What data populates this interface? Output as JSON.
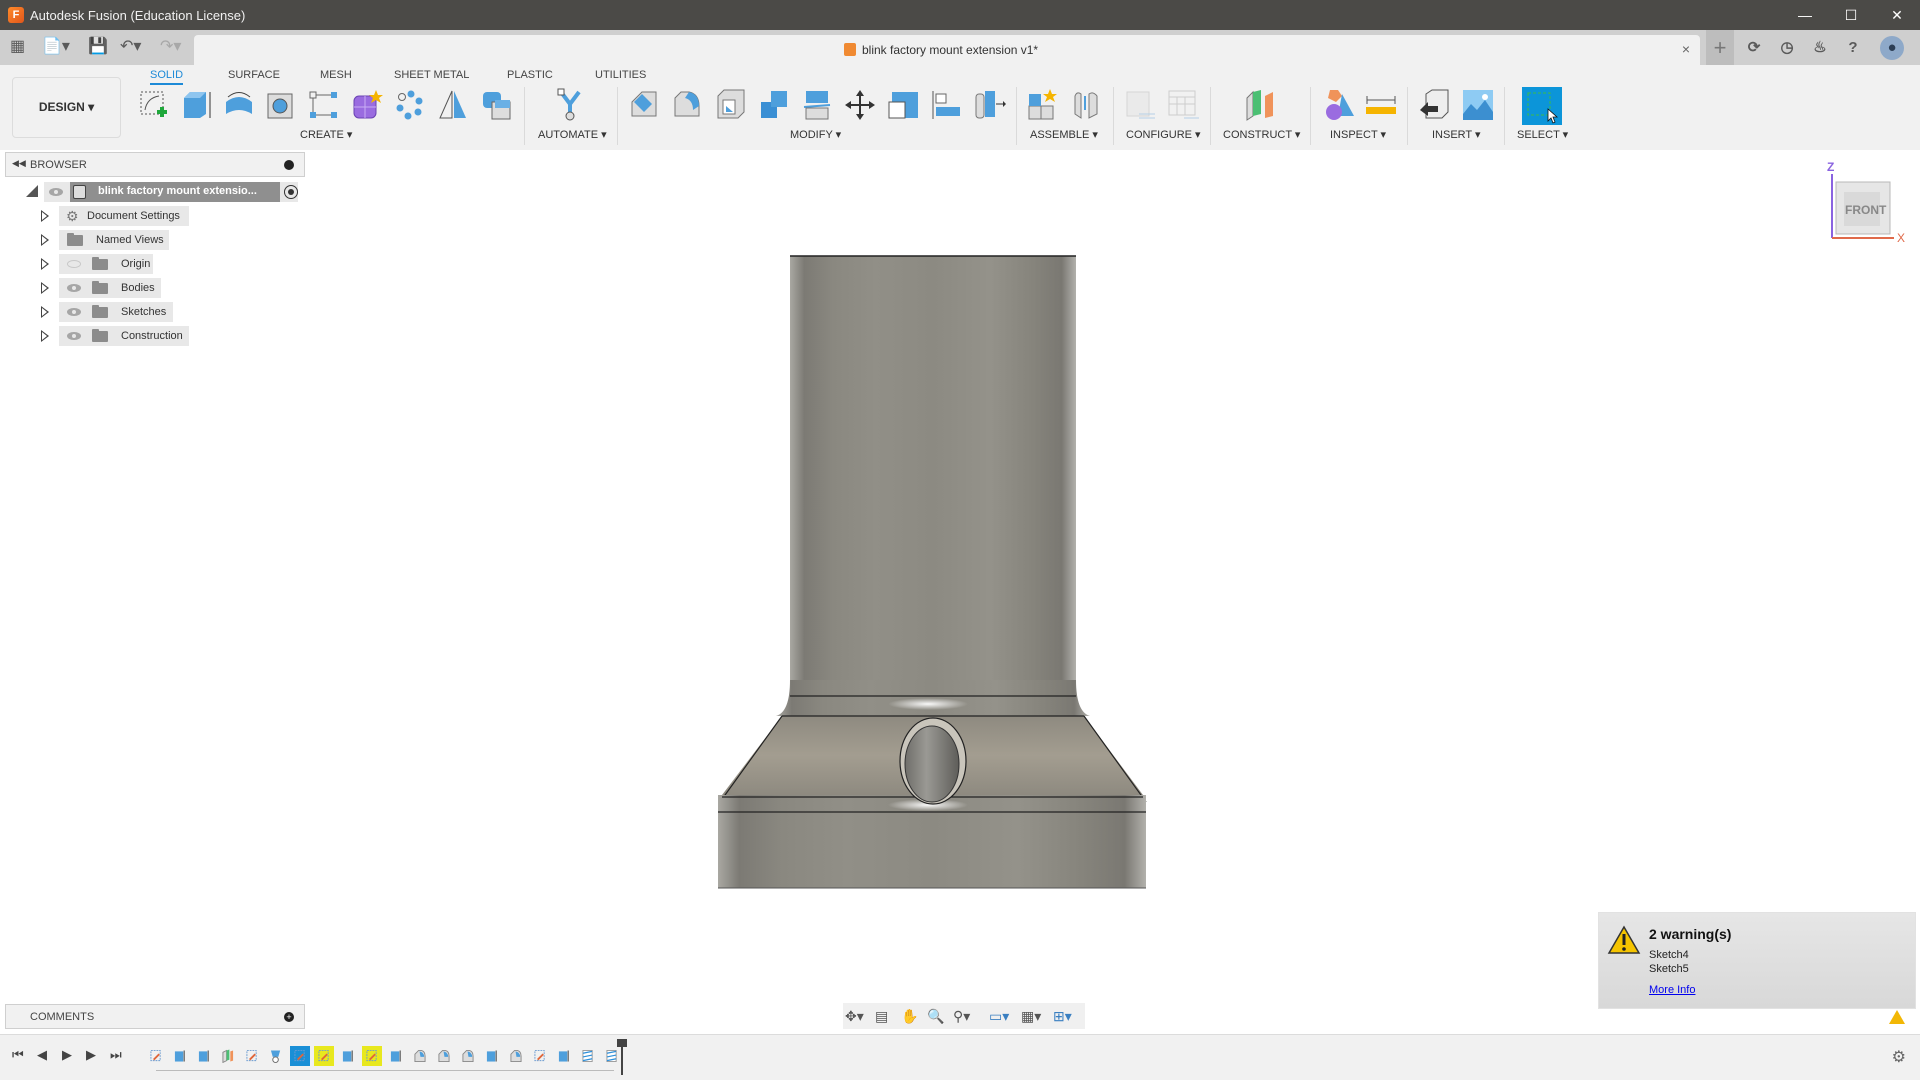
{
  "window": {
    "title": "Autodesk Fusion (Education License)",
    "controls": [
      "minimize",
      "maximize",
      "close"
    ]
  },
  "tabbar": {
    "quick_access": [
      "grid-menu",
      "file-menu",
      "save",
      "undo",
      "redo"
    ],
    "document_tab": {
      "title": "blink factory mount extension v1*",
      "close_glyph": "×"
    },
    "right_icons": [
      "new-tab",
      "sync",
      "job-status",
      "notifications",
      "help",
      "profile"
    ]
  },
  "toolbar": {
    "workspace_button": "DESIGN ▾",
    "tabs": [
      {
        "label": "SOLID",
        "active": true
      },
      {
        "label": "SURFACE",
        "active": false
      },
      {
        "label": "MESH",
        "active": false
      },
      {
        "label": "SHEET METAL",
        "active": false
      },
      {
        "label": "PLASTIC",
        "active": false
      },
      {
        "label": "UTILITIES",
        "active": false
      }
    ],
    "groups": [
      {
        "label": "CREATE ▾",
        "tools": [
          "create-sketch",
          "extrude",
          "revolve",
          "hole",
          "rectangular-pattern-sketch",
          "form",
          "pattern",
          "mirror",
          "combine"
        ]
      },
      {
        "label": "AUTOMATE ▾",
        "tools": [
          "automate"
        ]
      },
      {
        "label": "MODIFY ▾",
        "tools": [
          "press-pull",
          "fillet",
          "shell",
          "combine",
          "offset-face",
          "move",
          "scale",
          "align",
          "split-body"
        ]
      },
      {
        "label": "ASSEMBLE ▾",
        "tools": [
          "new-component",
          "joint"
        ]
      },
      {
        "label": "CONFIGURE ▾",
        "tools": [
          "configure",
          "table"
        ]
      },
      {
        "label": "CONSTRUCT ▾",
        "tools": [
          "offset-plane"
        ]
      },
      {
        "label": "INSPECT ▾",
        "tools": [
          "interference",
          "measure"
        ]
      },
      {
        "label": "INSERT ▾",
        "tools": [
          "insert-derive",
          "decal"
        ]
      },
      {
        "label": "SELECT ▾",
        "tools": [
          "select"
        ]
      }
    ]
  },
  "browser": {
    "header": "BROWSER",
    "root": "blink factory mount extensio...",
    "items": [
      {
        "label": "Document Settings",
        "icon": "gear",
        "visible": null
      },
      {
        "label": "Named Views",
        "icon": "folder",
        "visible": null
      },
      {
        "label": "Origin",
        "icon": "folder",
        "visible": false
      },
      {
        "label": "Bodies",
        "icon": "folder",
        "visible": true
      },
      {
        "label": "Sketches",
        "icon": "folder",
        "visible": true
      },
      {
        "label": "Construction",
        "icon": "folder",
        "visible": true
      }
    ]
  },
  "viewcube": {
    "face": "FRONT",
    "axis_z": "Z",
    "axis_x": "X"
  },
  "comments": {
    "label": "COMMENTS"
  },
  "warning": {
    "title": "2 warning(s)",
    "items": [
      "Sketch4",
      "Sketch5"
    ],
    "link": "More Info"
  },
  "navbar": {
    "tools": [
      "orbit",
      "look-at",
      "pan",
      "zoom",
      "fit",
      "display-settings",
      "grid-settings",
      "viewports"
    ]
  },
  "timeline": {
    "playback": [
      "⏮",
      "◀",
      "▶",
      "▶",
      "⏭"
    ],
    "features": [
      "sketch",
      "extrude",
      "extrude",
      "plane",
      "sketch",
      "revolve",
      "sketch",
      "sketch",
      "extrude",
      "sketch",
      "extrude",
      "fillet",
      "fillet",
      "fillet",
      "extrude",
      "fillet",
      "sketch",
      "extrude",
      "thread",
      "thread"
    ],
    "selected_blue_index": 6,
    "selected_yellow_indices": [
      7,
      9
    ]
  },
  "colors": {
    "accent": "#1d8ad7",
    "titlebar": "#4b4a47",
    "warning": "#f2b705",
    "model_metal": "#8a8780"
  }
}
